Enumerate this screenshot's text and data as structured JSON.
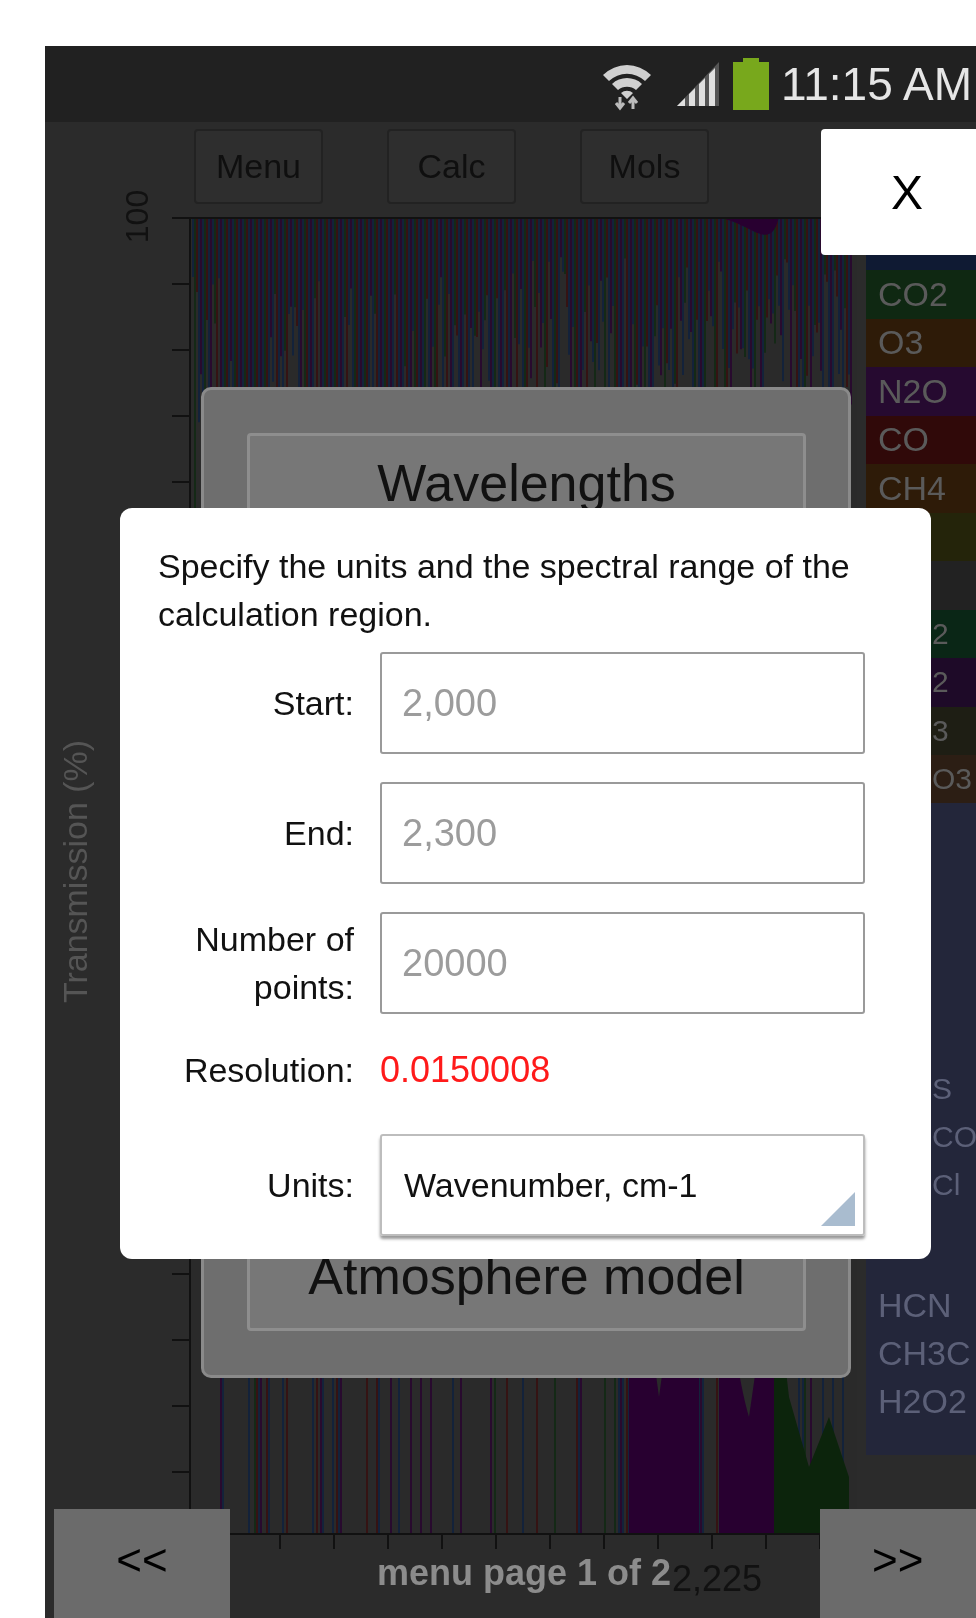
{
  "status_bar": {
    "time": "11:15 AM"
  },
  "toolbar": {
    "buttons": [
      "Menu",
      "Calc",
      "Mols"
    ]
  },
  "close_button": {
    "label": "X"
  },
  "chart": {
    "ylabel": "Transmission (%)",
    "y_tick_label": "100",
    "x_tick_labels": [
      "2,225"
    ]
  },
  "legend": [
    {
      "label": "CO2",
      "color": "#0f2812",
      "kind": "full"
    },
    {
      "label": "O3",
      "color": "#2e1b08",
      "kind": "full"
    },
    {
      "label": "N2O",
      "color": "#260a30",
      "kind": "full"
    },
    {
      "label": "CO",
      "color": "#300909",
      "kind": "full"
    },
    {
      "label": "CH4",
      "color": "#2e1b08",
      "kind": "full"
    },
    {
      "color": "#24240a"
    },
    {
      "color": "#222222"
    },
    {
      "label": "2",
      "color": "#0a2616",
      "kind": "partial"
    },
    {
      "label": "2",
      "color": "#1e0a28",
      "kind": "partial"
    },
    {
      "label": "3",
      "color": "#1e1e14",
      "kind": "partial"
    },
    {
      "label": "O3",
      "color": "#2c1e14",
      "kind": "partial"
    }
  ],
  "legend_more_upper": [
    {
      "label": "S",
      "kind": "partial"
    },
    {
      "label": "CO",
      "kind": "partial"
    },
    {
      "label": "Cl",
      "kind": "partial"
    }
  ],
  "legend_more_lower": [
    {
      "label": "HCN"
    },
    {
      "label": "CH3C"
    },
    {
      "label": "H2O2"
    }
  ],
  "menu_panel": {
    "buttons": [
      "Wavelengths",
      "Atmosphere model"
    ],
    "page_label": "menu page 1 of 2",
    "prev_button": "<<",
    "next_button": ">>"
  },
  "dialog": {
    "message": "Specify the units and the spectral range of the calculation region.",
    "fields": [
      {
        "label": "Start:",
        "placeholder": "2,000"
      },
      {
        "label": "End:",
        "placeholder": "2,300"
      },
      {
        "label": "Number of points:",
        "placeholder": "20000"
      }
    ],
    "resolution": {
      "label": "Resolution:",
      "value": "0.0150008"
    },
    "units": {
      "label": "Units:",
      "value": "Wavenumber, cm-1"
    }
  }
}
